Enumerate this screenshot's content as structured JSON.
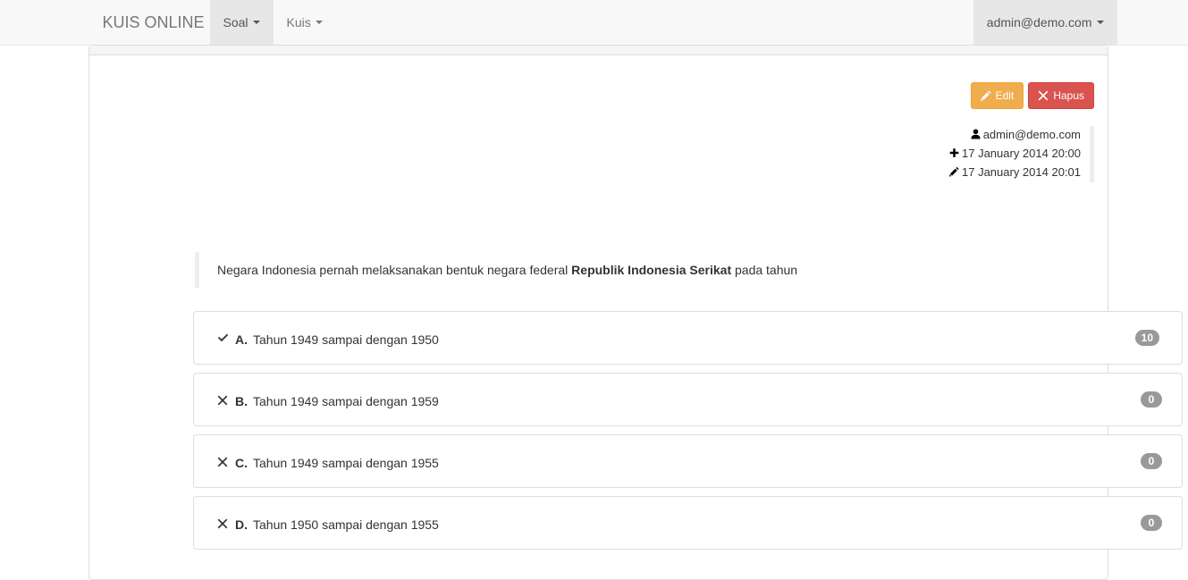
{
  "navbar": {
    "brand": "KUIS ONLINE",
    "items": [
      {
        "label": "Soal",
        "active": true,
        "caret": true,
        "name": "nav-item-soal"
      },
      {
        "label": "Kuis",
        "active": false,
        "caret": true,
        "name": "nav-item-kuis"
      }
    ],
    "user": {
      "label": "admin@demo.com",
      "caret": true
    }
  },
  "toolbar": {
    "edit_label": "Edit",
    "delete_label": "Hapus",
    "edit_icon": "pencil-icon",
    "delete_icon": "times-icon",
    "edit_color": "#f0ad4e",
    "delete_color": "#d9534f"
  },
  "meta": {
    "author_icon": "user-icon",
    "author": "admin@demo.com",
    "created_icon": "plus-icon",
    "created": "17 January 2014 20:00",
    "updated_icon": "pencil-icon",
    "updated": "17 January 2014 20:01"
  },
  "question": {
    "prefix": "Negara Indonesia pernah melaksanakan bentuk negara federal ",
    "emphasis": "Republik Indonesia Serikat",
    "suffix": " pada tahun"
  },
  "options": [
    {
      "mark": "check-icon",
      "mark_glyph": "✔",
      "letter": "A.",
      "text": "Tahun 1949 sampai dengan 1950",
      "badge": "10",
      "correct": true
    },
    {
      "mark": "times-icon",
      "mark_glyph": "✖",
      "letter": "B.",
      "text": "Tahun 1949 sampai dengan 1959",
      "badge": "0",
      "correct": false
    },
    {
      "mark": "times-icon",
      "mark_glyph": "✖",
      "letter": "C.",
      "text": "Tahun 1949 sampai dengan 1955",
      "badge": "0",
      "correct": false
    },
    {
      "mark": "times-icon",
      "mark_glyph": "✖",
      "letter": "D.",
      "text": "Tahun 1950 sampai dengan 1955",
      "badge": "0",
      "correct": false
    }
  ],
  "colors": {
    "navbar_bg": "#f8f8f8",
    "navbar_active_bg": "#e7e7e7",
    "panel_border": "#dddddd",
    "badge_bg": "#999999",
    "quote_border": "#eeeeee"
  }
}
